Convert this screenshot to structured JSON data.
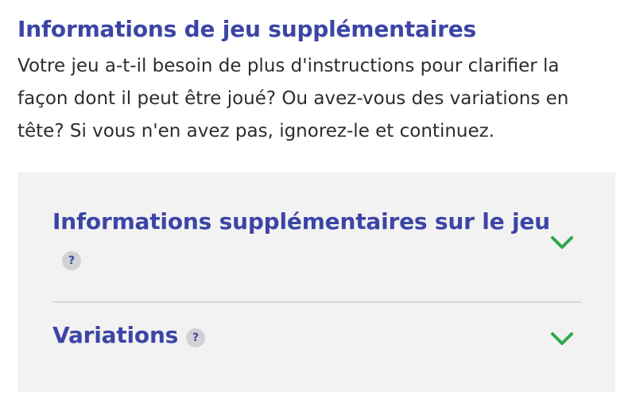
{
  "section": {
    "title": "Informations de jeu supplémentaires",
    "description": "Votre jeu a-t-il besoin de plus d'instructions pour clarifier la façon dont il peut être joué? Ou avez-vous des variations en tête? Si vous n'en avez pas, ignorez-le et continuez."
  },
  "accordion": {
    "items": [
      {
        "label": "Informations supplémentaires sur le jeu",
        "help_glyph": "?",
        "icon": "chevron-down-icon",
        "expanded": false
      },
      {
        "label": "Variations",
        "help_glyph": "?",
        "icon": "chevron-down-icon",
        "expanded": false
      }
    ]
  },
  "colors": {
    "heading": "#3c45a6",
    "text": "#2d2d2d",
    "panel_background": "#f2f2f2",
    "chevron": "#2ea84a",
    "help_badge": "#d2d2d4"
  }
}
